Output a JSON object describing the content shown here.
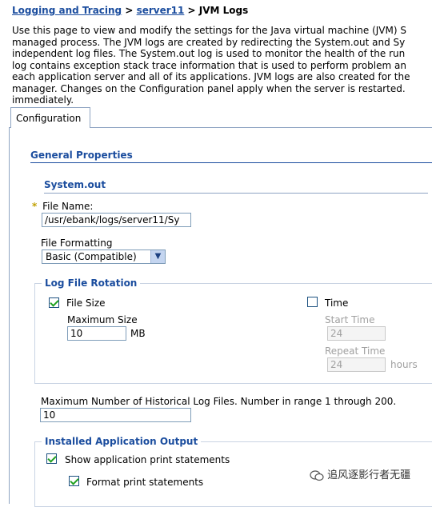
{
  "breadcrumb": {
    "link1": "Logging and Tracing",
    "sep1": " > ",
    "link2": "server11",
    "sep2": " > ",
    "current": "JVM Logs"
  },
  "description_lines": [
    "Use this page to view and modify the settings for the Java virtual machine (JVM) S",
    "managed process. The JVM logs are created by redirecting the System.out and Sy",
    "independent log files. The System.out log is used to monitor the health of the run",
    "log contains exception stack trace information that is used to perform problem an",
    "each application server and all of its applications. JVM logs are also created for the",
    "manager. Changes on the Configuration panel apply when the server is restarted.",
    "immediately."
  ],
  "tabs": {
    "configuration": "Configuration"
  },
  "general_properties": {
    "title": "General Properties"
  },
  "system_out": {
    "title": "System.out",
    "required_mark": "*",
    "file_name_label": "File Name:",
    "file_name_value": "/usr/ebank/logs/server11/Sy",
    "file_formatting_label": "File Formatting",
    "file_formatting_selected": "Basic (Compatible)"
  },
  "rotation": {
    "legend": "Log File Rotation",
    "file_size_label": "File Size",
    "file_size_checked": true,
    "max_size_label": "Maximum Size",
    "max_size_value": "10",
    "max_size_unit": "MB",
    "time_label": "Time",
    "time_checked": false,
    "start_time_label": "Start Time",
    "start_time_value": "24",
    "repeat_time_label": "Repeat Time",
    "repeat_time_value": "24",
    "repeat_time_unit": "hours"
  },
  "historical": {
    "label": "Maximum Number of Historical Log Files. Number in range 1 through 200.",
    "value": "10"
  },
  "app_output": {
    "legend": "Installed Application Output",
    "show_print_label": "Show application print statements",
    "show_print_checked": true,
    "format_print_label": "Format print statements",
    "format_print_checked": true
  },
  "watermark": {
    "text": "追风逐影行者无疆"
  },
  "colors": {
    "link": "#1b4d9e",
    "border": "#8ea3c2",
    "check": "#21a121"
  }
}
